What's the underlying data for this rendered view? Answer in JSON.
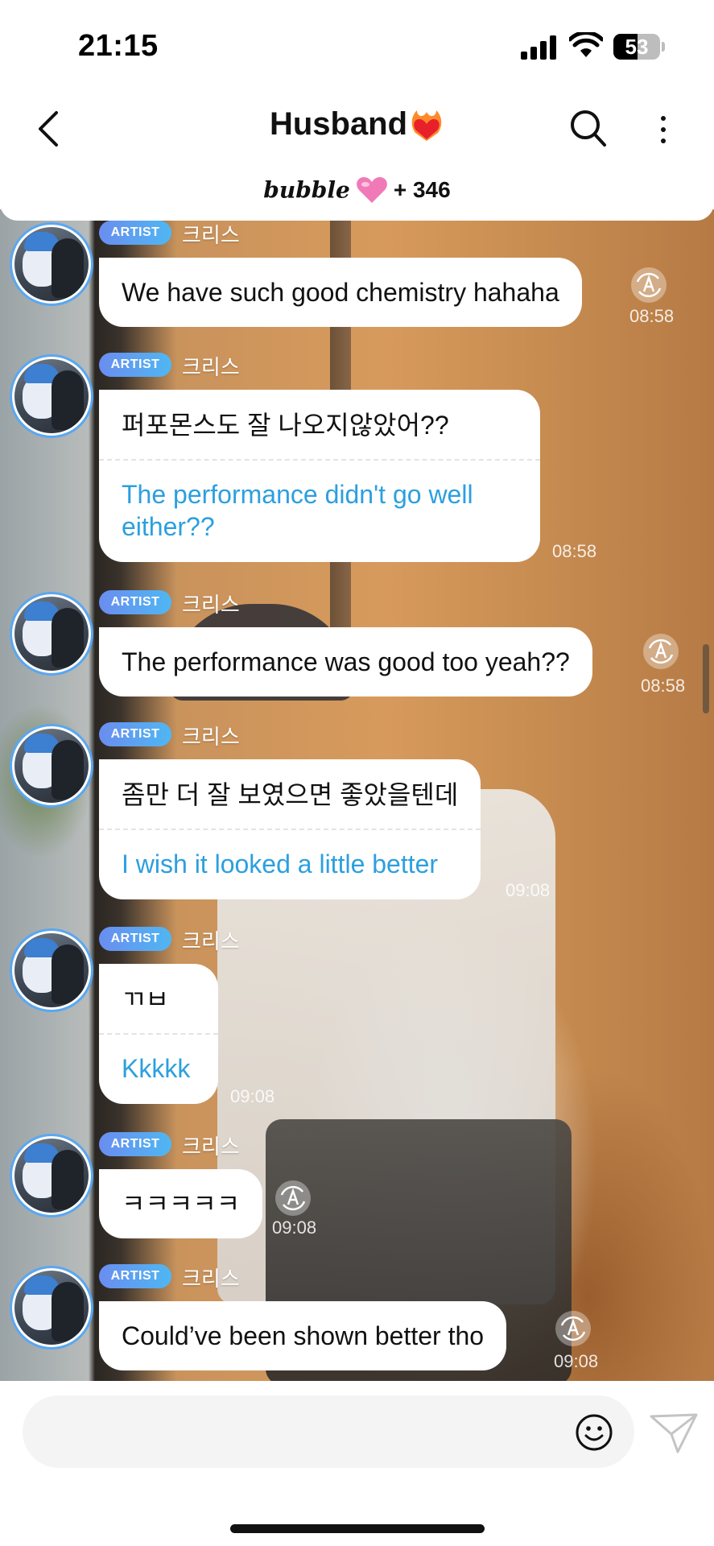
{
  "status_bar": {
    "time": "21:15",
    "battery_level": "53"
  },
  "header": {
    "title": "Husband",
    "title_emoji_icon": "heart-on-fire-icon",
    "brand": "bubble",
    "brand_icon": "pink-heart-icon",
    "subscriber_text": "+ 346"
  },
  "messages": [
    {
      "badge": "ARTIST",
      "sender": "크리스",
      "text": "We have such good chemistry hahaha",
      "time": "08:58",
      "translate_icon": true
    },
    {
      "badge": "ARTIST",
      "sender": "크리스",
      "text": "퍼포몬스도 잘 나오지않았어??",
      "translation": "The performance didn't go well either??",
      "time": "08:58"
    },
    {
      "badge": "ARTIST",
      "sender": "크리스",
      "text": "The performance was good too yeah??",
      "time": "08:58",
      "translate_icon": true
    },
    {
      "badge": "ARTIST",
      "sender": "크리스",
      "text": "좀만 더 잘 보였으면 좋았을텐데",
      "translation": "I wish it looked a little better",
      "time": "09:08"
    },
    {
      "badge": "ARTIST",
      "sender": "크리스",
      "text": "ㄲㅂ",
      "translation": "Kkkkk",
      "time": "09:08"
    },
    {
      "badge": "ARTIST",
      "sender": "크리스",
      "text": "ㅋㅋㅋㅋㅋ",
      "time": "09:08",
      "translate_icon": true
    },
    {
      "badge": "ARTIST",
      "sender": "크리스",
      "text": "Could’ve been shown better tho",
      "time": "09:08",
      "translate_icon": true
    }
  ],
  "input": {
    "placeholder": "",
    "value": ""
  },
  "icons": {
    "back": "chevron-left-icon",
    "search": "search-icon",
    "more": "more-vertical-icon",
    "emoji": "smiley-icon",
    "send": "paper-plane-icon",
    "translate": "auto-translate-icon"
  },
  "colors": {
    "accent_blue": "#2c9fdf",
    "badge_start": "#6a8df0",
    "badge_end": "#4fb7f2",
    "avatar_ring": "#5aa7f0"
  }
}
